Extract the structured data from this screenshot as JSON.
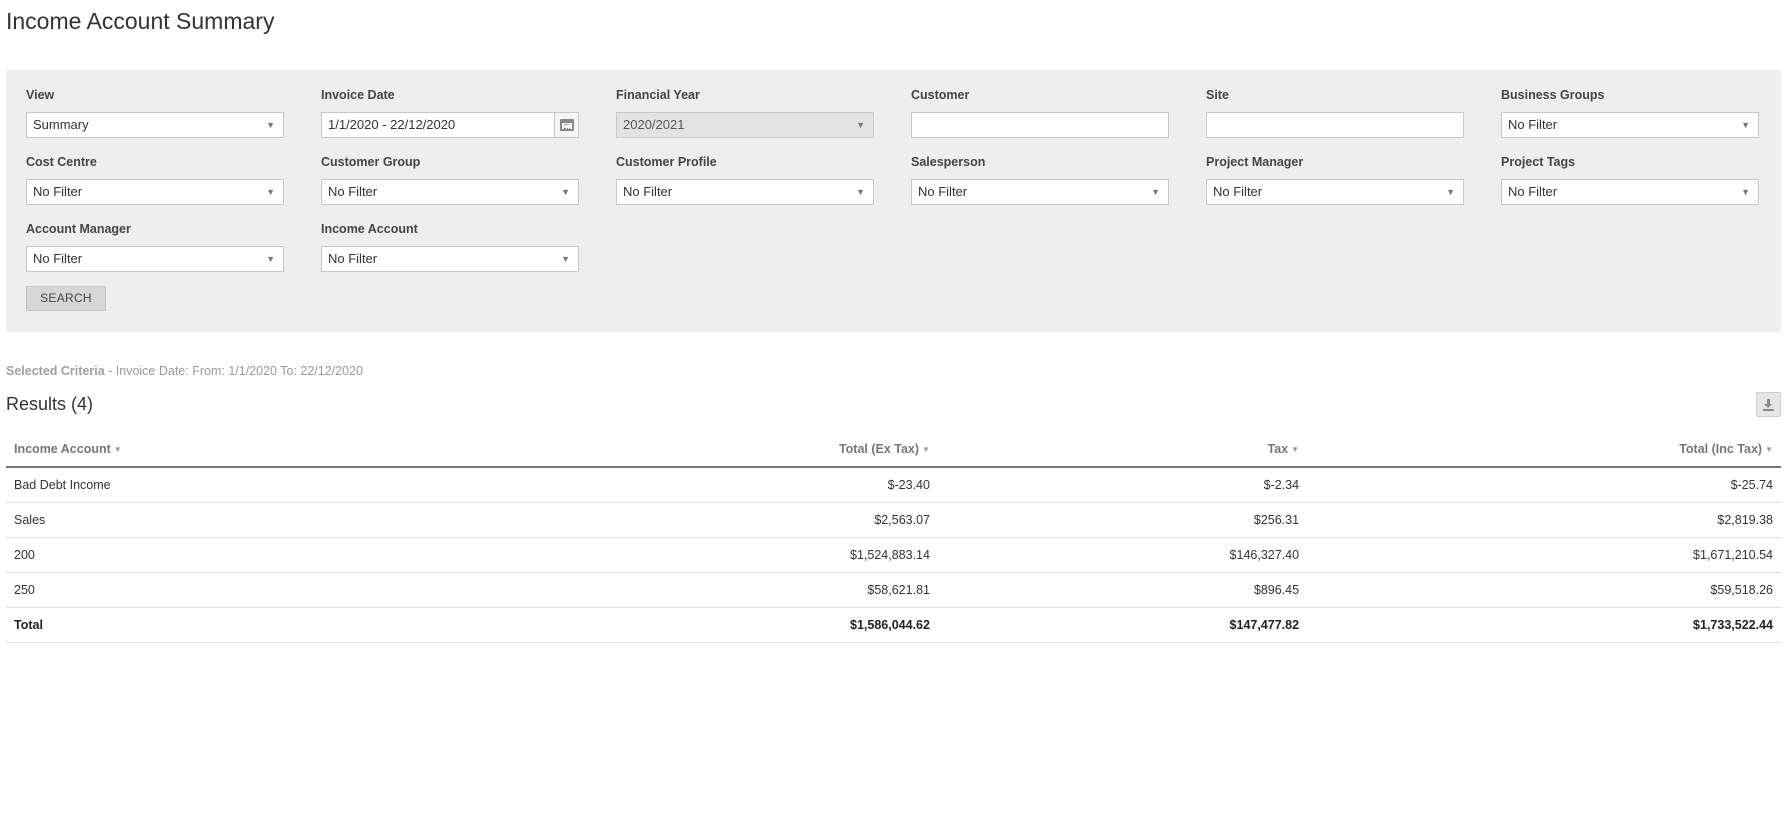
{
  "page": {
    "title": "Income Account Summary"
  },
  "filters": {
    "view": {
      "label": "View",
      "value": "Summary"
    },
    "invoice_date": {
      "label": "Invoice Date",
      "value": "1/1/2020 - 22/12/2020"
    },
    "financial_year": {
      "label": "Financial Year",
      "value": "2020/2021"
    },
    "customer": {
      "label": "Customer",
      "value": ""
    },
    "site": {
      "label": "Site",
      "value": ""
    },
    "business_groups": {
      "label": "Business Groups",
      "value": "No Filter"
    },
    "cost_centre": {
      "label": "Cost Centre",
      "value": "No Filter"
    },
    "customer_group": {
      "label": "Customer Group",
      "value": "No Filter"
    },
    "customer_profile": {
      "label": "Customer Profile",
      "value": "No Filter"
    },
    "salesperson": {
      "label": "Salesperson",
      "value": "No Filter"
    },
    "project_manager": {
      "label": "Project Manager",
      "value": "No Filter"
    },
    "project_tags": {
      "label": "Project Tags",
      "value": "No Filter"
    },
    "account_manager": {
      "label": "Account Manager",
      "value": "No Filter"
    },
    "income_account": {
      "label": "Income Account",
      "value": "No Filter"
    },
    "search_label": "SEARCH"
  },
  "criteria": {
    "label": "Selected Criteria",
    "text": " - Invoice Date: From: 1/1/2020 To: 22/12/2020"
  },
  "results": {
    "title": "Results (4)",
    "columns": {
      "income_account": "Income Account",
      "total_ex_tax": "Total (Ex Tax)",
      "tax": "Tax",
      "total_inc_tax": "Total (Inc Tax)"
    },
    "rows": [
      {
        "income_account": "Bad Debt Income",
        "total_ex_tax": "$-23.40",
        "tax": "$-2.34",
        "total_inc_tax": "$-25.74"
      },
      {
        "income_account": "Sales",
        "total_ex_tax": "$2,563.07",
        "tax": "$256.31",
        "total_inc_tax": "$2,819.38"
      },
      {
        "income_account": "200",
        "total_ex_tax": "$1,524,883.14",
        "tax": "$146,327.40",
        "total_inc_tax": "$1,671,210.54"
      },
      {
        "income_account": "250",
        "total_ex_tax": "$58,621.81",
        "tax": "$896.45",
        "total_inc_tax": "$59,518.26"
      }
    ],
    "total": {
      "income_account": "Total",
      "total_ex_tax": "$1,586,044.62",
      "tax": "$147,477.82",
      "total_inc_tax": "$1,733,522.44"
    }
  },
  "icons": {
    "select_caret": "caret-down-icon",
    "date_picker": "calendar-icon",
    "download": "download-icon",
    "sort": "sort-caret-icon"
  }
}
